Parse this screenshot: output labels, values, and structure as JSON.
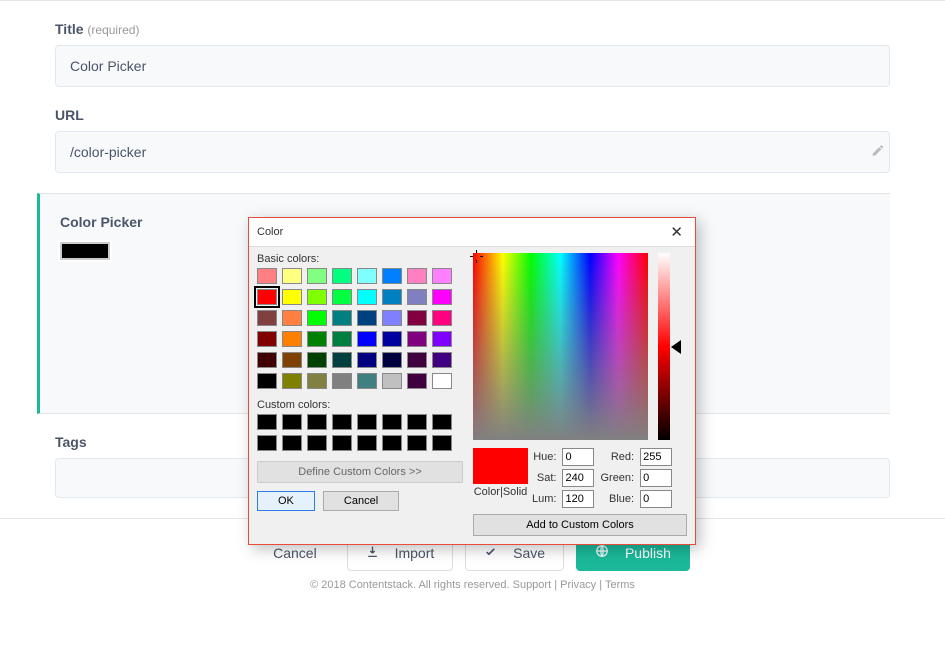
{
  "title_field": {
    "label": "Title",
    "hint": "(required)",
    "value": "Color Picker"
  },
  "url_field": {
    "label": "URL",
    "value": "/color-picker"
  },
  "card": {
    "title": "Color Picker",
    "swatch_color": "#000000"
  },
  "tags_field": {
    "label": "Tags"
  },
  "footer": {
    "cancel": "Cancel",
    "import": "Import",
    "save": "Save",
    "publish": "Publish",
    "copyright": "© 2018 Contentstack. All rights reserved.",
    "link_support": "Support",
    "link_privacy": "Privacy",
    "link_terms": "Terms"
  },
  "dialog": {
    "title": "Color",
    "basic_label": "Basic colors:",
    "custom_label": "Custom colors:",
    "define_label": "Define Custom Colors >>",
    "ok": "OK",
    "cancel": "Cancel",
    "preview_label": "Color|Solid",
    "hue_label": "Hue:",
    "sat_label": "Sat:",
    "lum_label": "Lum:",
    "red_label": "Red:",
    "green_label": "Green:",
    "blue_label": "Blue:",
    "hue": "0",
    "sat": "240",
    "lum": "120",
    "red": "255",
    "green": "0",
    "blue": "0",
    "add_custom": "Add to Custom Colors",
    "basic_colors": [
      "#ff8080",
      "#ffff80",
      "#80ff80",
      "#00ff80",
      "#80ffff",
      "#0080ff",
      "#ff80c0",
      "#ff80ff",
      "#ff0000",
      "#ffff00",
      "#80ff00",
      "#00ff40",
      "#00ffff",
      "#0080c0",
      "#8080c0",
      "#ff00ff",
      "#804040",
      "#ff8040",
      "#00ff00",
      "#008080",
      "#004080",
      "#8080ff",
      "#800040",
      "#ff0080",
      "#800000",
      "#ff8000",
      "#008000",
      "#008040",
      "#0000ff",
      "#0000a0",
      "#800080",
      "#8000ff",
      "#400000",
      "#804000",
      "#004000",
      "#004040",
      "#000080",
      "#000040",
      "#400040",
      "#400080",
      "#000000",
      "#808000",
      "#808040",
      "#808080",
      "#408080",
      "#c0c0c0",
      "#400040",
      "#ffffff"
    ],
    "selected_index": 8
  }
}
